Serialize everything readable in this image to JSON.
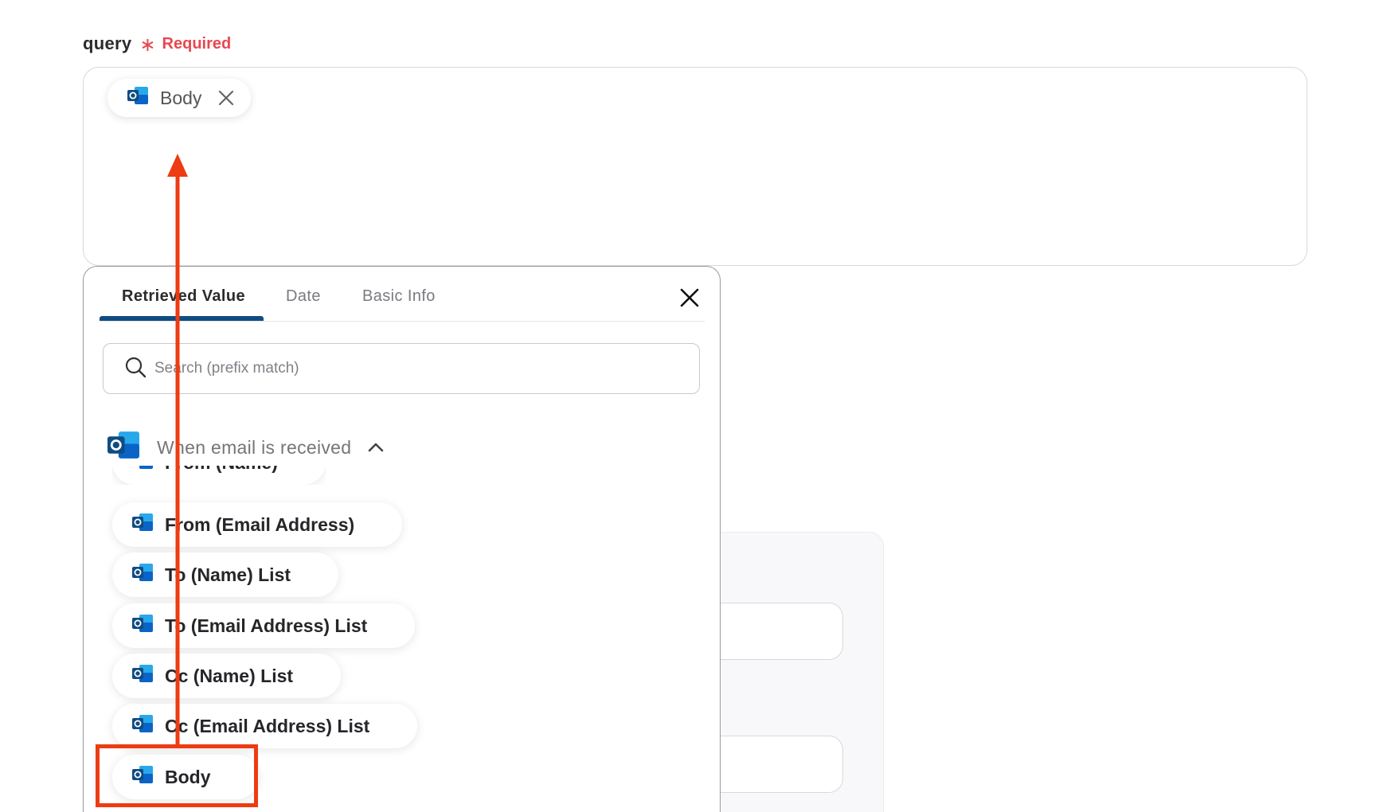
{
  "query_field": {
    "label": "query",
    "required_mark": "∗",
    "required_text": "Required",
    "chip": {
      "icon": "outlook-icon",
      "label": "Body",
      "remove_icon": "close-icon"
    }
  },
  "popup": {
    "tabs": [
      {
        "label": "Retrieved Value",
        "active": true
      },
      {
        "label": "Date",
        "active": false
      },
      {
        "label": "Basic Info",
        "active": false
      }
    ],
    "close_icon": "close-icon",
    "search": {
      "icon": "search-icon",
      "placeholder": "Search (prefix match)",
      "value": ""
    },
    "group": {
      "icon": "outlook-icon",
      "title": "When email is received",
      "toggle_icon": "chevron-up-icon"
    },
    "items": [
      {
        "label": "From (Name)",
        "partially_hidden": true
      },
      {
        "label": "From (Email Address)"
      },
      {
        "label": "To (Name) List"
      },
      {
        "label": "To (Email Address) List"
      },
      {
        "label": "Cc (Name) List"
      },
      {
        "label": "Cc (Email Address) List"
      },
      {
        "label": "Body",
        "highlighted": true
      }
    ]
  },
  "colors": {
    "required": "#e8474f",
    "tab_underline": "#0f4c81",
    "annotation": "#ee3b12",
    "outlook_blue": "#0a64c8"
  }
}
